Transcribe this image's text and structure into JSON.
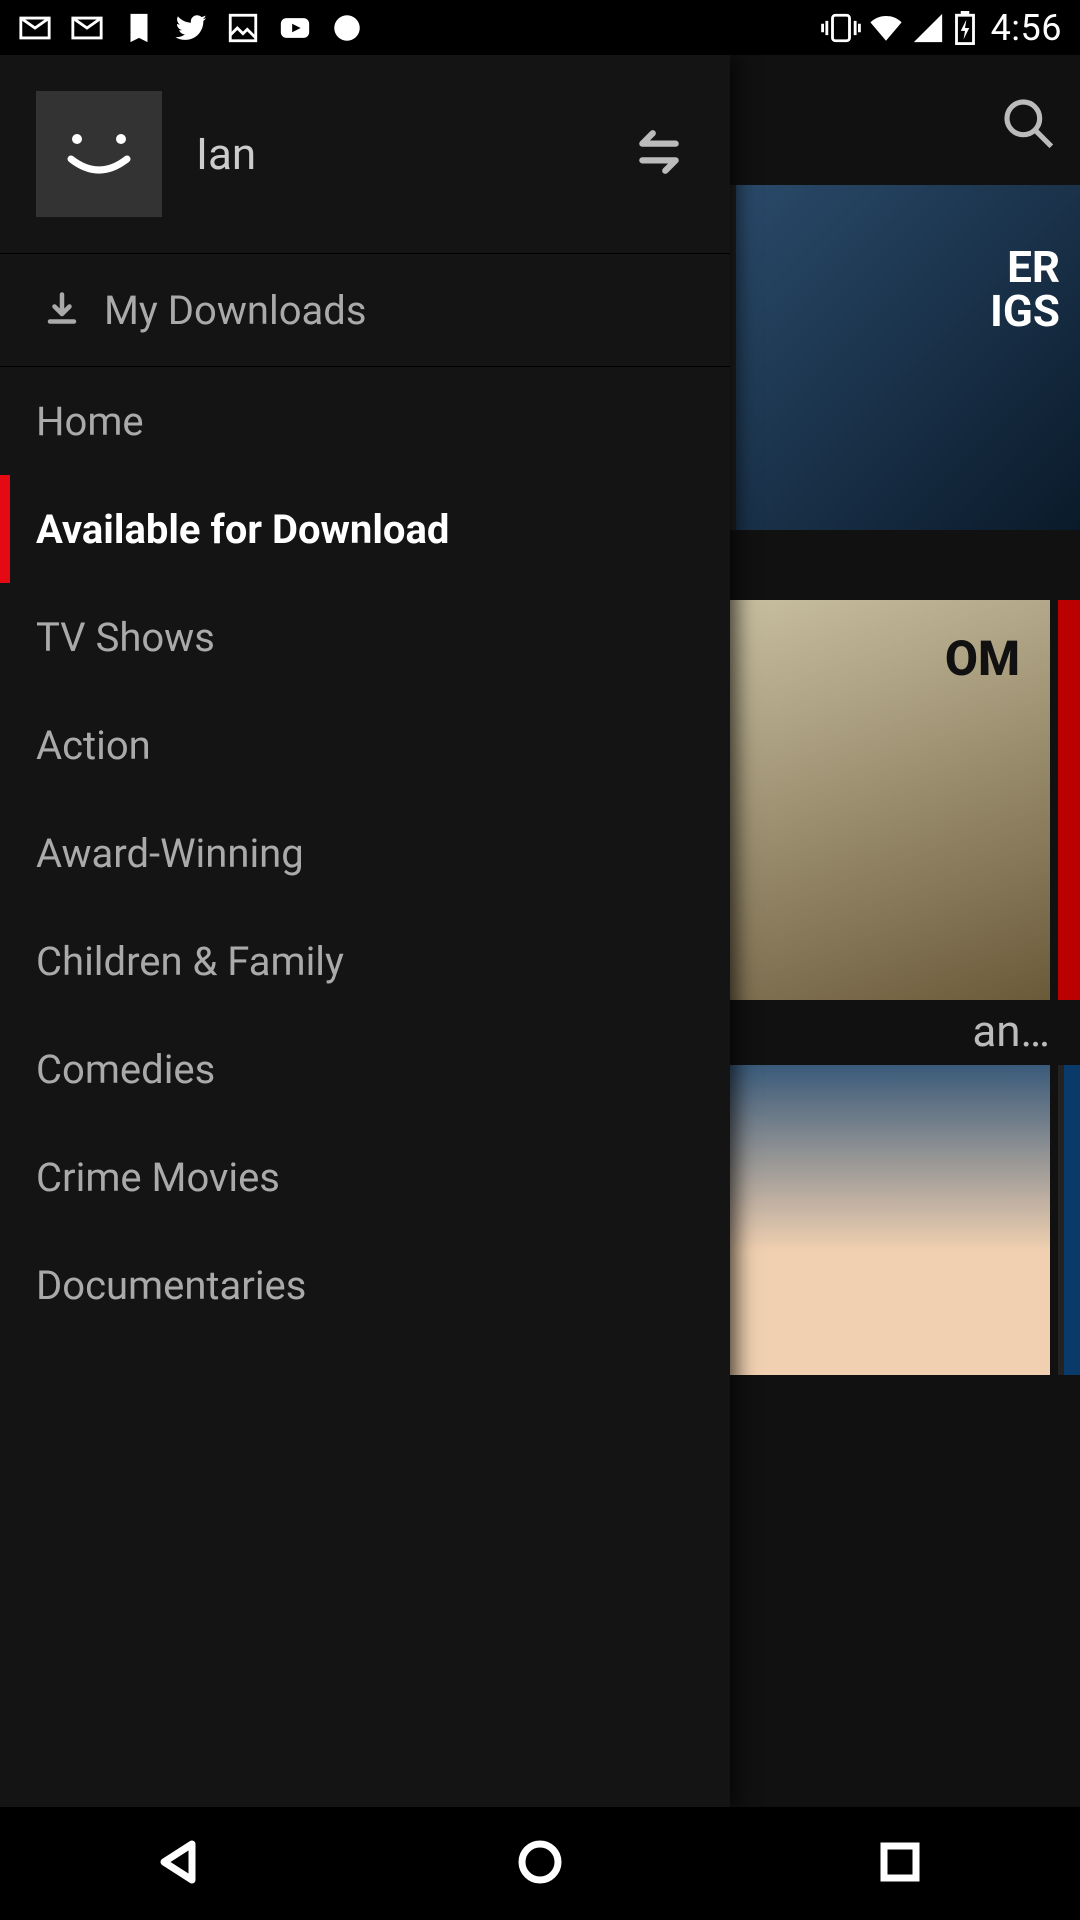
{
  "status_bar": {
    "time": "4:56"
  },
  "header": {
    "profile_name": "Ian"
  },
  "downloads_label": "My Downloads",
  "nav_items": [
    {
      "label": "Home",
      "active": false
    },
    {
      "label": "Available for Download",
      "active": true
    },
    {
      "label": "TV Shows",
      "active": false
    },
    {
      "label": "Action",
      "active": false
    },
    {
      "label": "Award-Winning",
      "active": false
    },
    {
      "label": "Children & Family",
      "active": false
    },
    {
      "label": "Comedies",
      "active": false
    },
    {
      "label": "Crime Movies",
      "active": false
    },
    {
      "label": "Documentaries",
      "active": false
    }
  ],
  "bg": {
    "poster1_text": "ER\nIGS",
    "poster2_text": "OM",
    "row_label": "an…"
  }
}
